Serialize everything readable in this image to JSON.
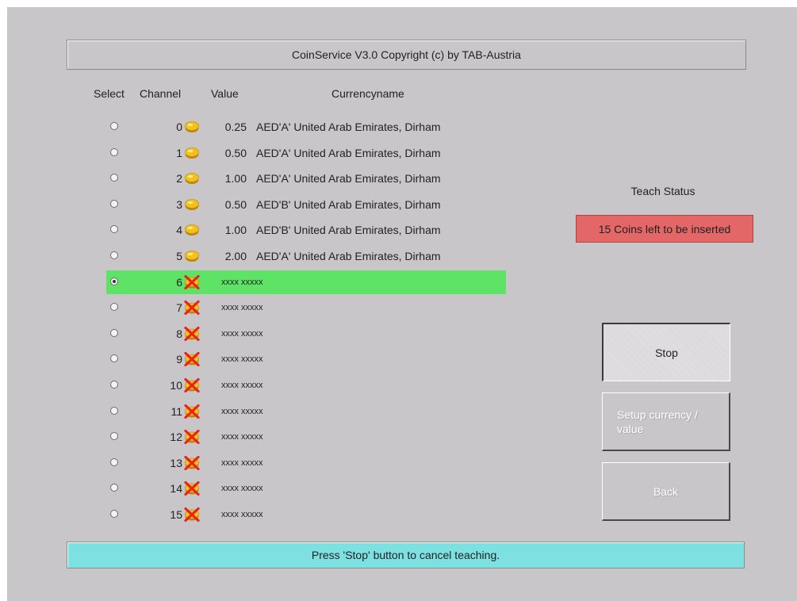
{
  "header": {
    "title": "CoinService V3.0 Copyright (c) by TAB-Austria"
  },
  "columns": {
    "select": "Select",
    "channel": "Channel",
    "value": "Value",
    "currency": "Currencyname"
  },
  "rows": [
    {
      "channel": "0",
      "value": "0.25",
      "currency": "AED'A' United Arab Emirates, Dirham",
      "icon": "coin-icon",
      "selected": false
    },
    {
      "channel": "1",
      "value": "0.50",
      "currency": "AED'A' United Arab Emirates, Dirham",
      "icon": "coin-icon",
      "selected": false
    },
    {
      "channel": "2",
      "value": "1.00",
      "currency": "AED'A' United Arab Emirates, Dirham",
      "icon": "coin-icon",
      "selected": false
    },
    {
      "channel": "3",
      "value": "0.50",
      "currency": "AED'B' United Arab Emirates, Dirham",
      "icon": "coin-icon",
      "selected": false
    },
    {
      "channel": "4",
      "value": "1.00",
      "currency": "AED'B' United Arab Emirates, Dirham",
      "icon": "coin-icon",
      "selected": false
    },
    {
      "channel": "5",
      "value": "2.00",
      "currency": "AED'A' United Arab Emirates, Dirham",
      "icon": "coin-icon",
      "selected": false
    },
    {
      "channel": "6",
      "placeholder": "xxxx xxxxx",
      "icon": "no-coin-icon",
      "selected": true
    },
    {
      "channel": "7",
      "placeholder": "xxxx xxxxx",
      "icon": "no-coin-icon",
      "selected": false
    },
    {
      "channel": "8",
      "placeholder": "xxxx xxxxx",
      "icon": "no-coin-icon",
      "selected": false
    },
    {
      "channel": "9",
      "placeholder": "xxxx xxxxx",
      "icon": "no-coin-icon",
      "selected": false
    },
    {
      "channel": "10",
      "placeholder": "xxxx xxxxx",
      "icon": "no-coin-icon",
      "selected": false
    },
    {
      "channel": "11",
      "placeholder": "xxxx xxxxx",
      "icon": "no-coin-icon",
      "selected": false
    },
    {
      "channel": "12",
      "placeholder": "xxxx xxxxx",
      "icon": "no-coin-icon",
      "selected": false
    },
    {
      "channel": "13",
      "placeholder": "xxxx xxxxx",
      "icon": "no-coin-icon",
      "selected": false
    },
    {
      "channel": "14",
      "placeholder": "xxxx xxxxx",
      "icon": "no-coin-icon",
      "selected": false
    },
    {
      "channel": "15",
      "placeholder": "xxxx xxxxx",
      "icon": "no-coin-icon",
      "selected": false
    }
  ],
  "teach": {
    "label": "Teach Status",
    "status": "15 Coins left to be inserted",
    "status_color": "#e46767"
  },
  "buttons": {
    "stop": "Stop",
    "setup": "Setup currency / value",
    "back": "Back"
  },
  "status_bar": {
    "message": "Press 'Stop' button to cancel teaching.",
    "color": "#7ee1e1"
  },
  "colors": {
    "window_bg": "#c9c6c9",
    "selected_row": "#5fe366"
  }
}
